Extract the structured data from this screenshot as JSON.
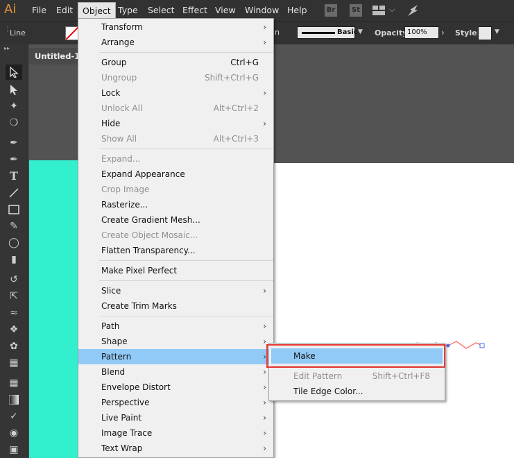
{
  "app": {
    "logo": "Ai"
  },
  "menubar": {
    "items": [
      "File",
      "Edit",
      "Object",
      "Type",
      "Select",
      "Effect",
      "View",
      "Window",
      "Help"
    ],
    "active": "Object",
    "badges": [
      "Br",
      "St"
    ]
  },
  "control_bar": {
    "left_label": "Line",
    "stroke_style": "Basic",
    "opacity_label": "Opacity:",
    "opacity_value": "100%",
    "style_label": "Style:"
  },
  "document": {
    "tab_title": "Untitled-1*"
  },
  "object_menu": {
    "groups": [
      [
        {
          "label": "Transform",
          "submenu": true
        },
        {
          "label": "Arrange",
          "submenu": true
        }
      ],
      [
        {
          "label": "Group",
          "shortcut": "Ctrl+G"
        },
        {
          "label": "Ungroup",
          "shortcut": "Shift+Ctrl+G",
          "disabled": true
        },
        {
          "label": "Lock",
          "submenu": true
        },
        {
          "label": "Unlock All",
          "shortcut": "Alt+Ctrl+2",
          "disabled": true
        },
        {
          "label": "Hide",
          "submenu": true
        },
        {
          "label": "Show All",
          "shortcut": "Alt+Ctrl+3",
          "disabled": true
        }
      ],
      [
        {
          "label": "Expand...",
          "disabled": true
        },
        {
          "label": "Expand Appearance"
        },
        {
          "label": "Crop Image",
          "disabled": true
        },
        {
          "label": "Rasterize..."
        },
        {
          "label": "Create Gradient Mesh..."
        },
        {
          "label": "Create Object Mosaic...",
          "disabled": true
        },
        {
          "label": "Flatten Transparency..."
        }
      ],
      [
        {
          "label": "Make Pixel Perfect"
        }
      ],
      [
        {
          "label": "Slice",
          "submenu": true
        },
        {
          "label": "Create Trim Marks"
        }
      ],
      [
        {
          "label": "Path",
          "submenu": true
        },
        {
          "label": "Shape",
          "submenu": true
        },
        {
          "label": "Pattern",
          "submenu": true,
          "highlighted": true
        },
        {
          "label": "Blend",
          "submenu": true
        },
        {
          "label": "Envelope Distort",
          "submenu": true
        },
        {
          "label": "Perspective",
          "submenu": true
        },
        {
          "label": "Live Paint",
          "submenu": true
        },
        {
          "label": "Image Trace",
          "submenu": true
        },
        {
          "label": "Text Wrap",
          "submenu": true
        }
      ]
    ]
  },
  "pattern_submenu": {
    "items": [
      {
        "label": "Make",
        "highlighted": true
      },
      {
        "label": "Edit Pattern",
        "shortcut": "Shift+Ctrl+F8",
        "disabled": true
      },
      {
        "label": "Tile Edge Color..."
      }
    ]
  },
  "tools": [
    "selection-tool",
    "direct-selection-tool",
    "magic-wand-tool",
    "lasso-tool",
    "pen-tool",
    "curvature-tool",
    "type-tool",
    "line-tool",
    "rectangle-tool",
    "paintbrush-tool",
    "shaper-tool",
    "eraser-tool",
    "rotate-tool",
    "scale-tool",
    "warp-tool",
    "free-transform-tool",
    "symbol-sprayer-tool",
    "column-graph-tool",
    "mesh-tool",
    "gradient-tool",
    "eyedropper-tool",
    "blend-tool",
    "slice-tool"
  ],
  "colors": {
    "highlight": "#91c9f7",
    "callout": "#e53935",
    "teal_shape": "#32f0ce",
    "zigzag": "#ff7a7a"
  }
}
